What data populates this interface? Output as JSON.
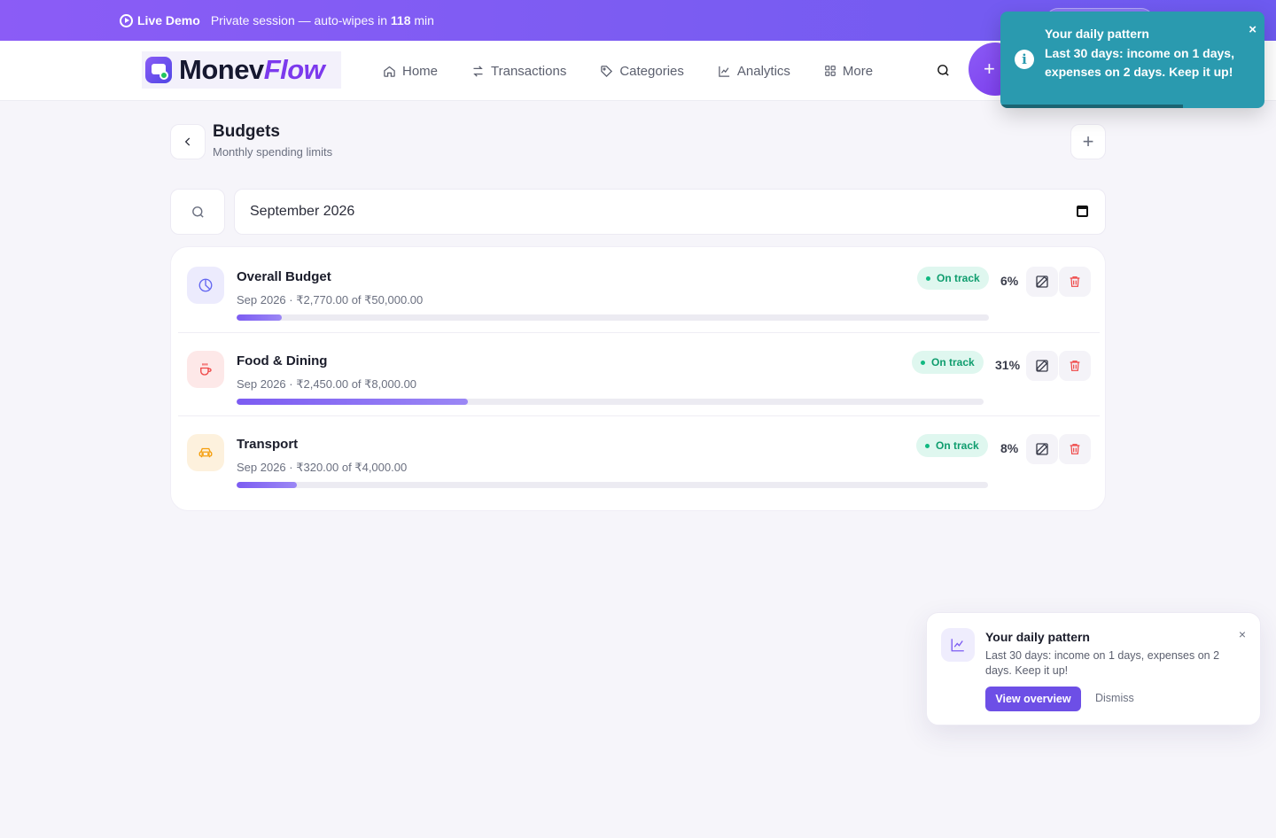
{
  "demo": {
    "live_label": "Live Demo",
    "session_prefix": "Private session — auto-wipes in ",
    "minutes": "118",
    "session_suffix": " min"
  },
  "brand": {
    "part1": "Monev",
    "part2": "Flow"
  },
  "nav": {
    "items": [
      {
        "label": "Home",
        "icon": "home-icon"
      },
      {
        "label": "Transactions",
        "icon": "arrows-swap-icon"
      },
      {
        "label": "Categories",
        "icon": "tag-icon"
      },
      {
        "label": "Analytics",
        "icon": "chart-line-icon"
      },
      {
        "label": "More",
        "icon": "grid-icon"
      }
    ],
    "add_label": "+"
  },
  "page": {
    "title": "Budgets",
    "subtitle": "Monthly spending limits",
    "add_label": "+"
  },
  "filter": {
    "month": "September 2026"
  },
  "budgets": [
    {
      "name": "Overall Budget",
      "meta": "Sep 2026 · ₹2,770.00 of ₹50,000.00",
      "status": "On track",
      "percent_label": "6%",
      "progress": 0.06,
      "icon": "pie-chart-icon",
      "icon_color": "#6366f1",
      "icon_bg": "#ecebfd"
    },
    {
      "name": "Food & Dining",
      "meta": "Sep 2026 · ₹2,450.00 of ₹8,000.00",
      "status": "On track",
      "percent_label": "31%",
      "progress": 0.31,
      "icon": "coffee-icon",
      "icon_color": "#ef4444",
      "icon_bg": "#fde8e8"
    },
    {
      "name": "Transport",
      "meta": "Sep 2026 · ₹320.00 of ₹4,000.00",
      "status": "On track",
      "percent_label": "8%",
      "progress": 0.08,
      "icon": "car-icon",
      "icon_color": "#f59e0b",
      "icon_bg": "#fdf1dd"
    }
  ],
  "toast": {
    "title": "Your daily pattern",
    "body": "Last 30 days: income on 1 days, expenses on 2 days. Keep it up!",
    "close": "×",
    "progress": 0.69
  },
  "notification": {
    "title": "Your daily pattern",
    "body": "Last 30 days: income on 1 days, expenses on 2 days. Keep it up!",
    "primary_label": "View overview",
    "dismiss_label": "Dismiss",
    "close": "×"
  },
  "colors": {
    "accent": "#7c5cf2",
    "success": "#10b981",
    "danger": "#ef4444",
    "toast_bg": "#2a9aaf"
  }
}
